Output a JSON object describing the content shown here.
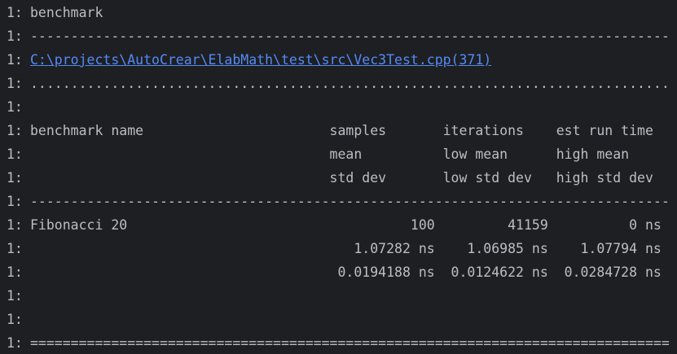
{
  "prefix": "1:",
  "colors": {
    "background": "#1e1f22",
    "text": "#bcbec4",
    "link": "#548af7"
  },
  "lines": [
    "benchmark",
    "-------------------------------------------------------------------------------",
    "C:\\projects\\AutoCrear\\ElabMath\\test\\src\\Vec3Test.cpp(371)",
    "...............................................................................",
    "",
    "benchmark name                       samples       iterations    est run time",
    "                                     mean          low mean      high mean",
    "                                     std dev       low std dev   high std dev",
    "-------------------------------------------------------------------------------",
    "Fibonacci 20                                   100         41159          0 ns",
    "                                        1.07282 ns    1.06985 ns    1.07794 ns",
    "                                      0.0194188 ns  0.0124622 ns  0.0284728 ns",
    "",
    "",
    "==============================================================================="
  ]
}
